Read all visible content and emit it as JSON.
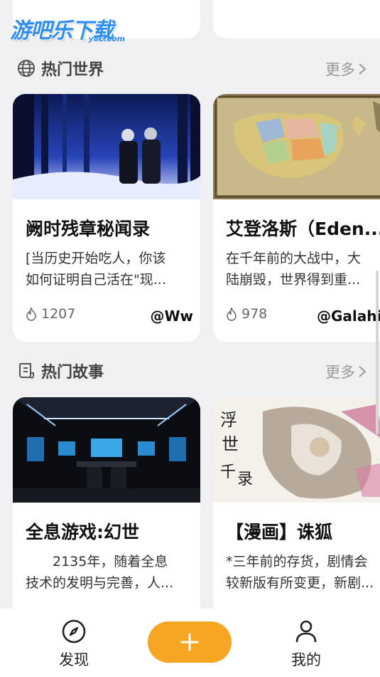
{
  "app": {
    "logo_text": "游吧乐下载",
    "logo_sub": "y8L.com"
  },
  "sections": {
    "worlds": {
      "title": "热门世界",
      "more": "更多"
    },
    "stories": {
      "title": "热门故事",
      "more": "更多"
    }
  },
  "world_cards": [
    {
      "title": "阙时残章秘闻录",
      "desc1": "[当历史开始吃人，你该",
      "desc2": "如何证明自己活在\"现...",
      "heat": "1207",
      "author": "@Ww",
      "image": "snowy-forest-figures-image"
    },
    {
      "title": "艾登洛斯（Eden...",
      "desc1": "在千年前的大战中，大",
      "desc2": "陆崩毁，世界得到重...",
      "heat": "978",
      "author": "@Galahir",
      "image": "fantasy-map-image"
    }
  ],
  "story_cards": [
    {
      "title": "全息游戏:幻世",
      "desc1": "　　2135年，随着全息",
      "desc2": "技术的发明与完善，人...",
      "image": "scifi-room-image"
    },
    {
      "title": "【漫画】诛狐",
      "desc1": "*三年前的存货，剧情会",
      "desc2": "较新版有所变更，新剧...",
      "image": "fox-manga-image"
    }
  ],
  "tabbar": {
    "discover": "发现",
    "add": "+",
    "mine": "我的"
  },
  "colors": {
    "accent": "#f6a623",
    "background": "#f0f0f3"
  }
}
